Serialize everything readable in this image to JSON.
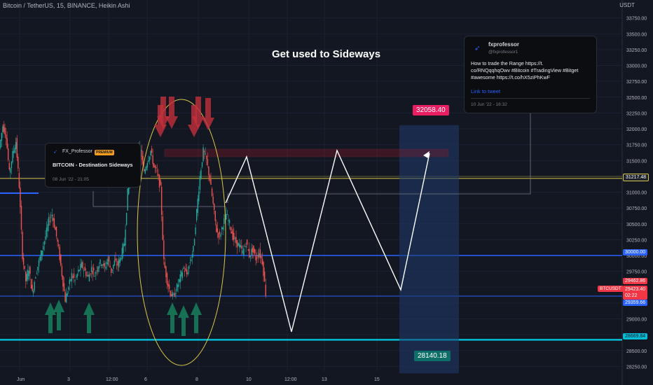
{
  "header": {
    "symbol_line": "Bitcoin / TetherUS, 15, BINANCE, Heikin Ashi",
    "currency": "USDT"
  },
  "title": "Get used to Sideways",
  "card_fxprof": {
    "name": "FX_Professor",
    "badge": "PREMIUM",
    "idea_title": "BITCOIN - Destination Sideways",
    "date": "08 Jun '22 - 21:05"
  },
  "card_tweet": {
    "name": "fxprofessor",
    "handle": "@fxprofessor1",
    "lines": [
      "How to trade the Range https://t.",
      "co/RNQqqhqOwv #Bitcoin #TradingView #Bitget",
      "#awesome https://t.co/hX5ziPhKwF"
    ],
    "link": "Link to tweet",
    "date": "10 Jun '22 - 16:32"
  },
  "range_box": {
    "top_label": "32058.40",
    "bottom_label": "28140.18"
  },
  "price_tags": {
    "line_31217": "31217.48",
    "line_30000": "30000.00",
    "tag_29462": "29462.86",
    "tag_29423": "29423.40",
    "timer": "02:22",
    "tag_29359": "29359.66",
    "line_28669": "28669.84",
    "symbol": "BTCUSDT"
  },
  "colors": {
    "background": "#131722",
    "blue_line": "#2962ff",
    "cyan_line": "#00bcd4",
    "red_tag": "#f23645",
    "pink_tag": "#e91e63",
    "teal_tag": "#0e6e68",
    "green_arrow": "#167a5a",
    "red_arrow": "#c2303c",
    "yellow_ellipse": "#d9c84a"
  },
  "chart_data": {
    "type": "candlestick",
    "series_name": "BTCUSDT",
    "y_axis_ticks": [
      33750,
      33500,
      33250,
      33000,
      32750,
      32500,
      32250,
      32000,
      31750,
      31500,
      31250,
      31000,
      30750,
      30500,
      30250,
      30000,
      29750,
      29500,
      29250,
      29000,
      28750,
      28500,
      28250
    ],
    "y_axis_tick_labels": [
      "33750.00",
      "33500.00",
      "33250.00",
      "33000.00",
      "32750.00",
      "32500.00",
      "32250.00",
      "32000.00",
      "31750.00",
      "31500.00",
      "31250.00",
      "31000.00",
      "30750.00",
      "30500.00",
      "30250.00",
      "30000.00",
      "29750.00",
      "29500.00",
      "29250.00",
      "29000.00",
      "28750.00",
      "28500.00",
      "28250.00"
    ],
    "x_axis_labels": [
      "Jun",
      "3",
      "12:00",
      "6",
      "8",
      "10",
      "12:00",
      "13",
      "15"
    ],
    "ylim": [
      28100,
      33950
    ],
    "close_path": [
      31700,
      32050,
      31900,
      31300,
      31600,
      31800,
      31100,
      30000,
      29600,
      29800,
      29400,
      29700,
      29900,
      30100,
      30300,
      30550,
      30650,
      30400,
      30100,
      29700,
      29300,
      29500,
      29700,
      29600,
      29750,
      29850,
      29750,
      29650,
      29800,
      29700,
      29850,
      29900,
      29800,
      29950,
      29750,
      29900,
      29850,
      30000,
      30200,
      31000,
      31400,
      31550,
      31700,
      31650,
      31300,
      31500,
      31650,
      31400,
      31300,
      31050,
      29900,
      29600,
      29400,
      29350,
      29500,
      29650,
      29800,
      29700,
      29900,
      30100,
      30700,
      31250,
      31650,
      31500,
      31200,
      30800,
      30400,
      30300,
      30500,
      30650,
      30500,
      30300,
      30200,
      30150,
      30050,
      30200,
      30000,
      30100,
      29950,
      30050,
      29900,
      29400
    ],
    "horizontal_levels": [
      31217.48,
      30000.0,
      29359.66,
      28669.84
    ],
    "projection_path": [
      [
        30800,
        31550
      ],
      [
        29700,
        28750
      ],
      [
        31650,
        29450
      ],
      [
        31550
      ]
    ],
    "range_box": [
      28140.18,
      32058.4
    ]
  }
}
